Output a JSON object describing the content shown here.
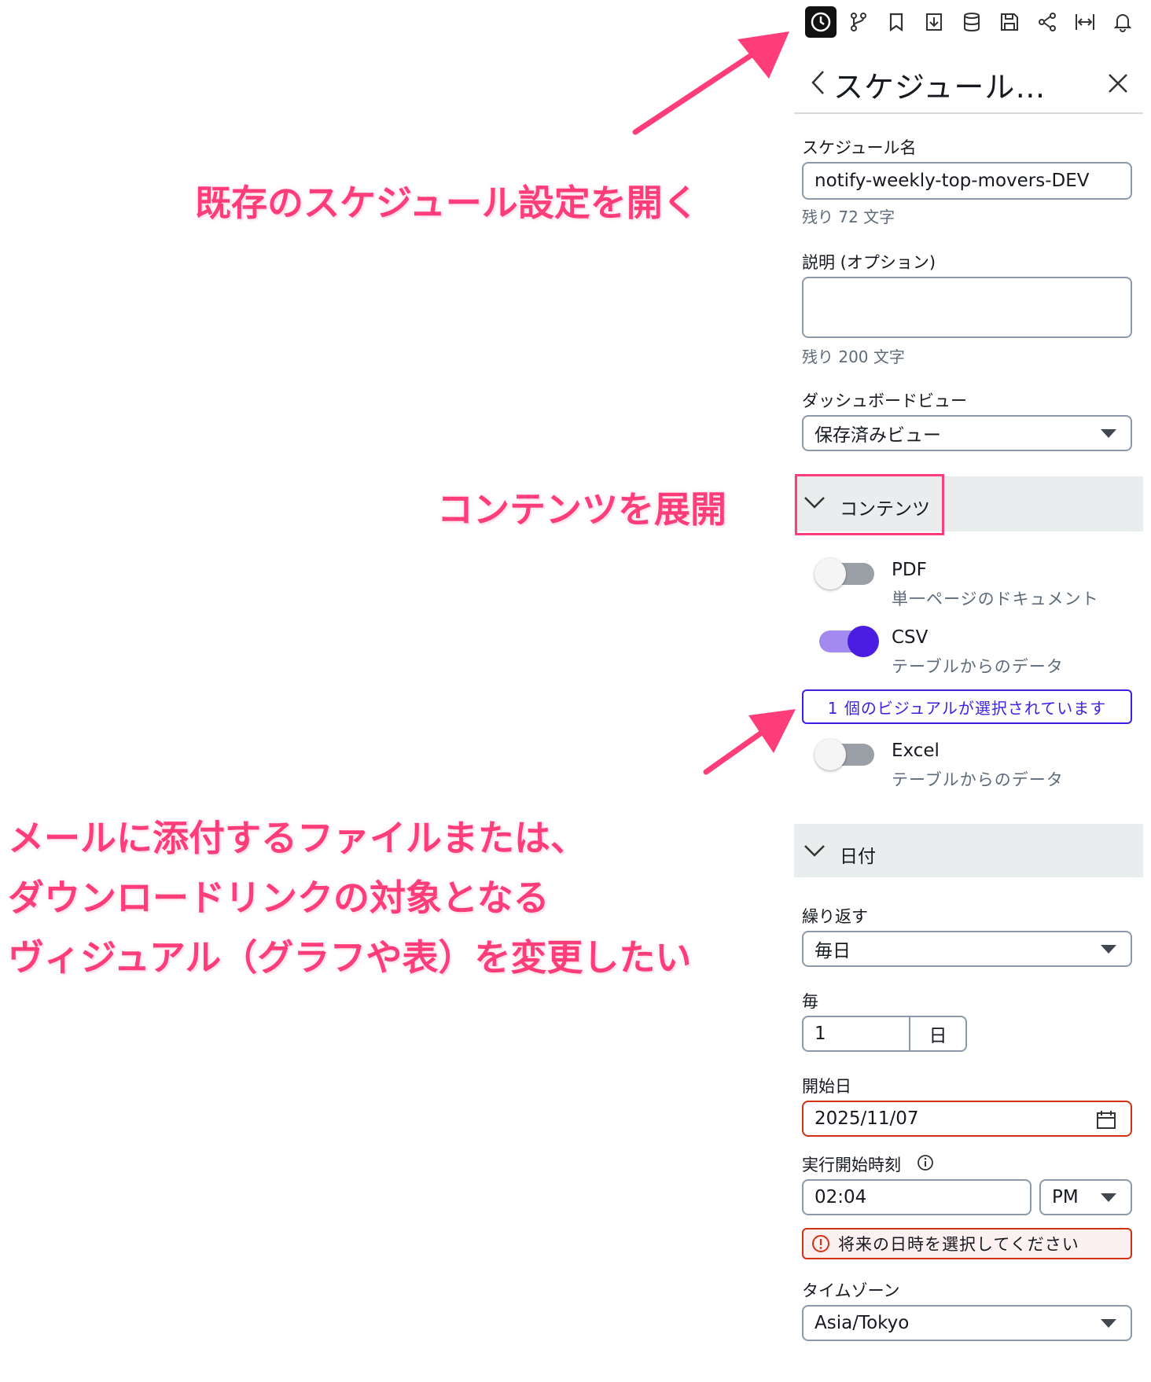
{
  "toolbar": {
    "icons": [
      "clock-icon",
      "branch-icon",
      "bookmark-icon",
      "download-icon",
      "database-icon",
      "save-icon",
      "share-icon",
      "fit-width-icon",
      "bell-icon"
    ]
  },
  "panel": {
    "title": "スケジュール…",
    "schedule_name": {
      "label": "スケジュール名",
      "value": "notify-weekly-top-movers-DEV",
      "hint": "残り 72 文字"
    },
    "description": {
      "label": "説明 (オプション)",
      "value": "",
      "hint": "残り 200 文字"
    },
    "dashboard_view": {
      "label": "ダッシュボードビュー",
      "value": "保存済みビュー"
    },
    "content_section": {
      "label": "コンテンツ",
      "pdf": {
        "title": "PDF",
        "subtitle": "単一ページのドキュメント",
        "enabled": false
      },
      "csv": {
        "title": "CSV",
        "subtitle": "テーブルからのデータ",
        "enabled": true
      },
      "csv_selection": "1 個のビジュアルが選択されています",
      "excel": {
        "title": "Excel",
        "subtitle": "テーブルからのデータ",
        "enabled": false
      }
    },
    "date_section": {
      "label": "日付",
      "repeat": {
        "label": "繰り返す",
        "value": "毎日"
      },
      "every": {
        "label": "毎",
        "value": "1",
        "unit": "日"
      },
      "start_date": {
        "label": "開始日",
        "value": "2025/11/07"
      },
      "start_time": {
        "label": "実行開始時刻",
        "value": "02:04",
        "ampm": "PM"
      },
      "error": "将来の日時を選択してください",
      "timezone": {
        "label": "タイムゾーン",
        "value": "Asia/Tokyo"
      }
    }
  },
  "annotations": {
    "open": "既存のスケジュール設定を開く",
    "expand": "コンテンツを展開",
    "change_line1": "メールに添付するファイルまたは、",
    "change_line2": "ダウンロードリンクの対象となる",
    "change_line3": "ヴィジュアル（グラフや表）を変更したい"
  },
  "colors": {
    "annotation": "#ff3d7a",
    "toggle_on": "#4a1de0",
    "error": "#d13212",
    "selection_border": "#3b21e6"
  }
}
